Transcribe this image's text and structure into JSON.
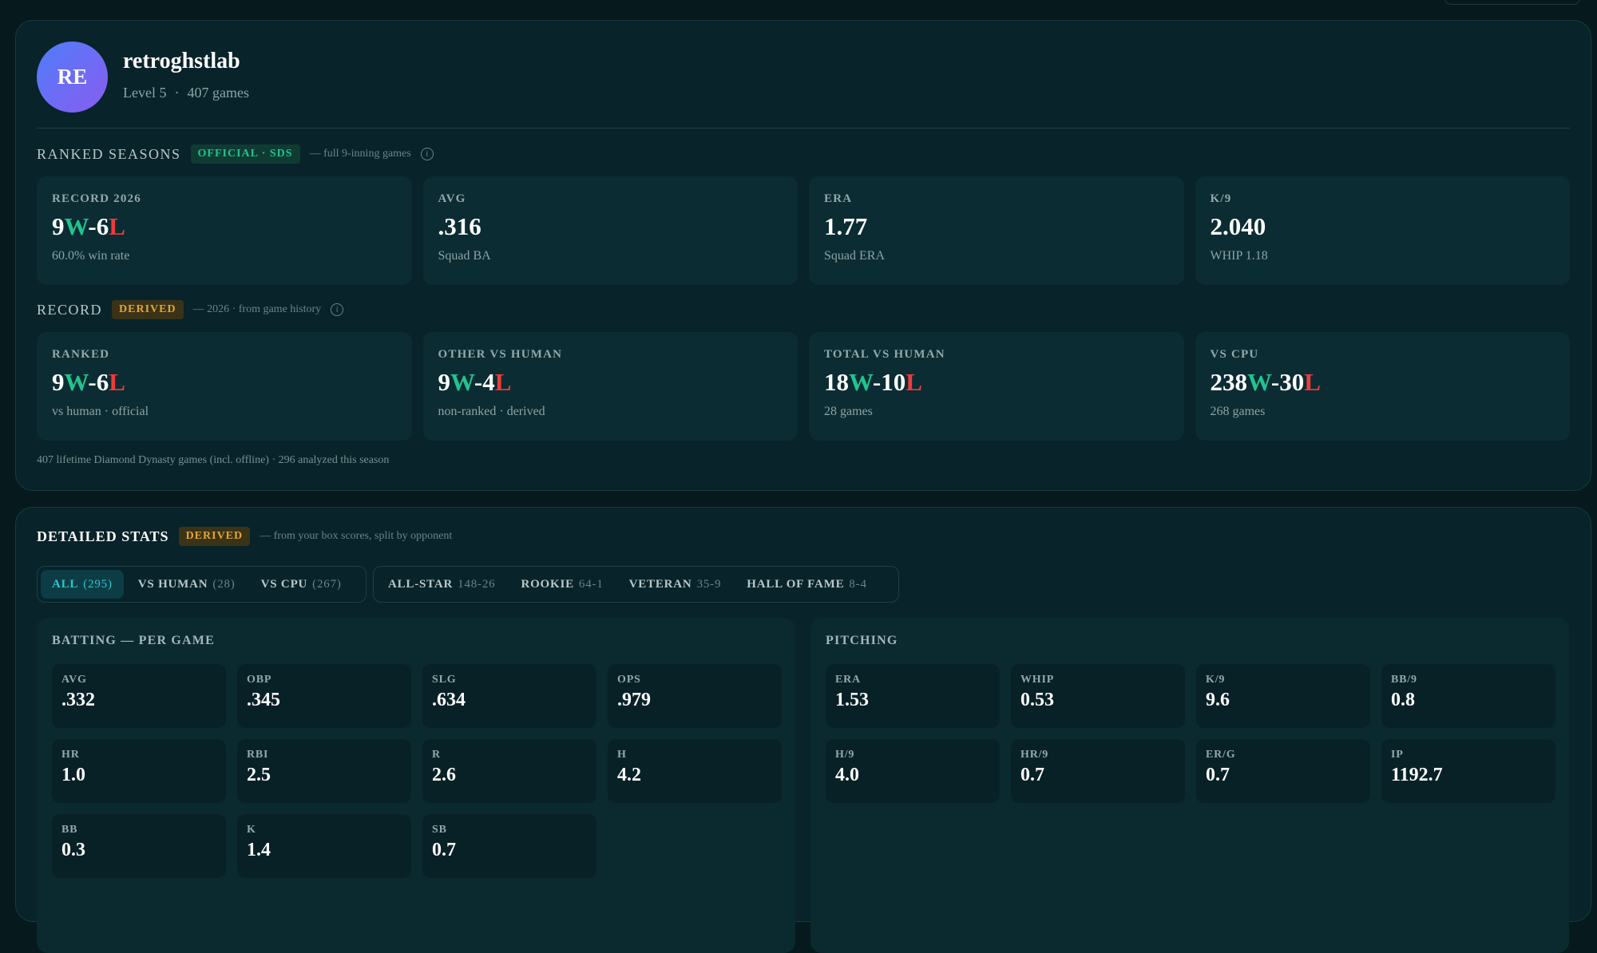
{
  "profile": {
    "initials": "RE",
    "username": "retroghstlab",
    "level": "Level 5",
    "separator": "·",
    "games": "407 games"
  },
  "ranked_seasons": {
    "title": "RANKED SEASONS",
    "badge": "OFFICIAL · SDS",
    "note": "— full 9-inning games",
    "info_icon": "info-icon",
    "cards": [
      {
        "label": "RECORD 2026",
        "wins": "9",
        "losses": "6",
        "sub": "60.0% win rate"
      },
      {
        "label": "AVG",
        "value": ".316",
        "sub": "Squad BA"
      },
      {
        "label": "ERA",
        "value": "1.77",
        "sub": "Squad ERA"
      },
      {
        "label": "K/9",
        "value": "2.040",
        "sub": "WHIP 1.18"
      }
    ]
  },
  "record": {
    "title": "RECORD",
    "badge": "DERIVED",
    "note": "— 2026 · from game history",
    "info_icon": "info-icon",
    "cards": [
      {
        "label": "RANKED",
        "wins": "9",
        "losses": "6",
        "sub": "vs human · official"
      },
      {
        "label": "OTHER VS HUMAN",
        "wins": "9",
        "losses": "4",
        "sub": "non-ranked · derived"
      },
      {
        "label": "TOTAL VS HUMAN",
        "wins": "18",
        "losses": "10",
        "sub": "28 games"
      },
      {
        "label": "VS CPU",
        "wins": "238",
        "losses": "30",
        "sub": "268 games"
      }
    ],
    "w_letter": "W",
    "l_letter": "L",
    "dash": "-",
    "footnote": "407 lifetime Diamond Dynasty games (incl. offline) · 296 analyzed this season"
  },
  "detailed": {
    "title": "DETAILED STATS",
    "badge": "DERIVED",
    "note": "— from your box scores, split by opponent",
    "filter_tabs": [
      {
        "label": "ALL",
        "count": "(295)",
        "active": true
      },
      {
        "label": "VS HUMAN",
        "count": "(28)"
      },
      {
        "label": "VS CPU",
        "count": "(267)"
      }
    ],
    "tier_tabs": [
      {
        "label": "ALL-STAR",
        "count": "148-26"
      },
      {
        "label": "ROOKIE",
        "count": "64-1"
      },
      {
        "label": "VETERAN",
        "count": "35-9"
      },
      {
        "label": "HALL OF FAME",
        "count": "8-4"
      }
    ],
    "batting": {
      "title": "BATTING — PER GAME",
      "stats": [
        {
          "label": "AVG",
          "value": ".332"
        },
        {
          "label": "OBP",
          "value": ".345"
        },
        {
          "label": "SLG",
          "value": ".634"
        },
        {
          "label": "OPS",
          "value": ".979"
        },
        {
          "label": "HR",
          "value": "1.0"
        },
        {
          "label": "RBI",
          "value": "2.5"
        },
        {
          "label": "R",
          "value": "2.6"
        },
        {
          "label": "H",
          "value": "4.2"
        },
        {
          "label": "BB",
          "value": "0.3"
        },
        {
          "label": "K",
          "value": "1.4"
        },
        {
          "label": "SB",
          "value": "0.7"
        }
      ]
    },
    "pitching": {
      "title": "PITCHING",
      "stats": [
        {
          "label": "ERA",
          "value": "1.53"
        },
        {
          "label": "WHIP",
          "value": "0.53"
        },
        {
          "label": "K/9",
          "value": "9.6"
        },
        {
          "label": "BB/9",
          "value": "0.8"
        },
        {
          "label": "H/9",
          "value": "4.0"
        },
        {
          "label": "HR/9",
          "value": "0.7"
        },
        {
          "label": "ER/G",
          "value": "0.7"
        },
        {
          "label": "IP",
          "value": "1192.7"
        }
      ]
    }
  },
  "colors": {
    "win": "#22c38e",
    "loss": "#ef3b3b",
    "accent": "#2bc5d0"
  }
}
